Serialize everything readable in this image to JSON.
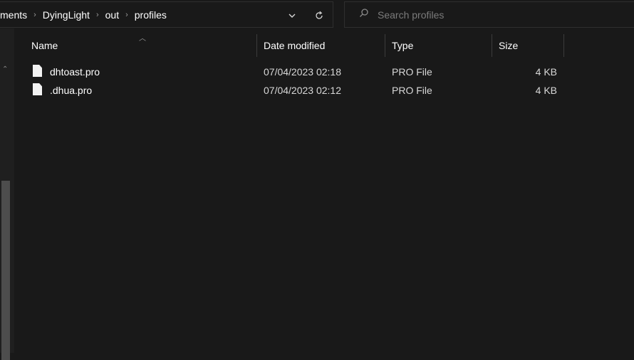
{
  "address_bar": {
    "breadcrumbs": [
      "ments",
      "DyingLight",
      "out",
      "profiles"
    ],
    "separator": "›",
    "dropdown_icon": "chevron-down-icon",
    "refresh_icon": "refresh-icon"
  },
  "search": {
    "placeholder": "Search profiles",
    "icon": "search-icon"
  },
  "columns": {
    "name": "Name",
    "date": "Date modified",
    "type": "Type",
    "size": "Size"
  },
  "sort": {
    "column": "name",
    "direction": "ascending"
  },
  "files": [
    {
      "name": "dhtoast.pro",
      "date": "07/04/2023 02:18",
      "type": "PRO File",
      "size": "4 KB"
    },
    {
      "name": ".dhua.pro",
      "date": "07/04/2023 02:12",
      "type": "PRO File",
      "size": "4 KB"
    }
  ],
  "colors": {
    "background": "#191919",
    "text": "#ffffff",
    "muted_text": "#d8d8d8",
    "border": "#2f2f2f"
  }
}
